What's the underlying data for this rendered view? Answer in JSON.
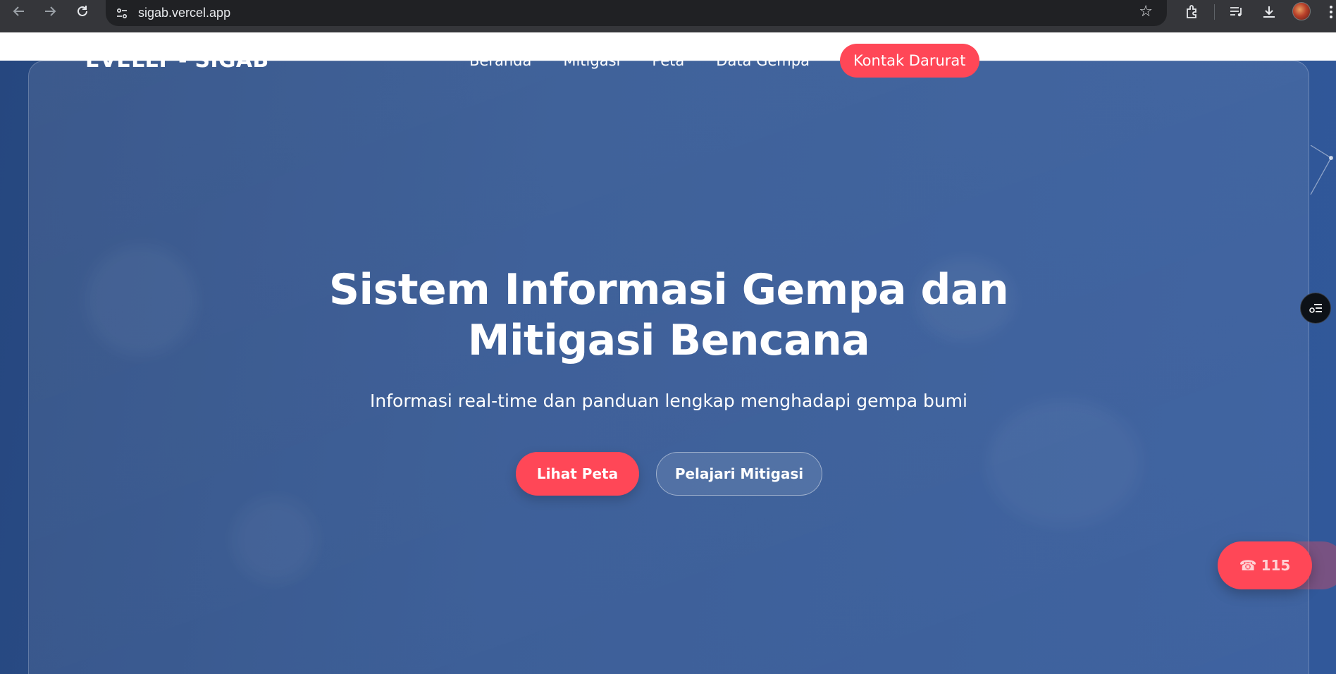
{
  "browser": {
    "url": "sigab.vercel.app",
    "icons": [
      "back-arrow-icon",
      "forward-arrow-icon",
      "reload-icon",
      "site-settings-icon",
      "bookmark-star-icon",
      "extensions-icon",
      "reading-list-icon",
      "download-icon",
      "profile-avatar",
      "more-menu-icon"
    ]
  },
  "header": {
    "brand": "EVELLY - SIGAB",
    "nav": [
      {
        "label": "Beranda"
      },
      {
        "label": "Mitigasi"
      },
      {
        "label": "Peta"
      },
      {
        "label": "Data Gempa"
      }
    ],
    "cta_label": "Kontak Darurat"
  },
  "hero": {
    "title_line1": "Sistem Informasi Gempa dan",
    "title_line2": "Mitigasi Bencana",
    "subtitle": "Informasi real-time dan panduan lengkap menghadapi gempa bumi",
    "primary_button": "Lihat Peta",
    "secondary_button": "Pelajari Mitigasi"
  },
  "floating": {
    "emergency_icon": "telephone-icon",
    "emergency_number": "115",
    "side_widget_icon": "filter-list-icon"
  },
  "colors": {
    "accent": "#ff4757",
    "background": "#2d5290",
    "chrome": "#35363a"
  }
}
